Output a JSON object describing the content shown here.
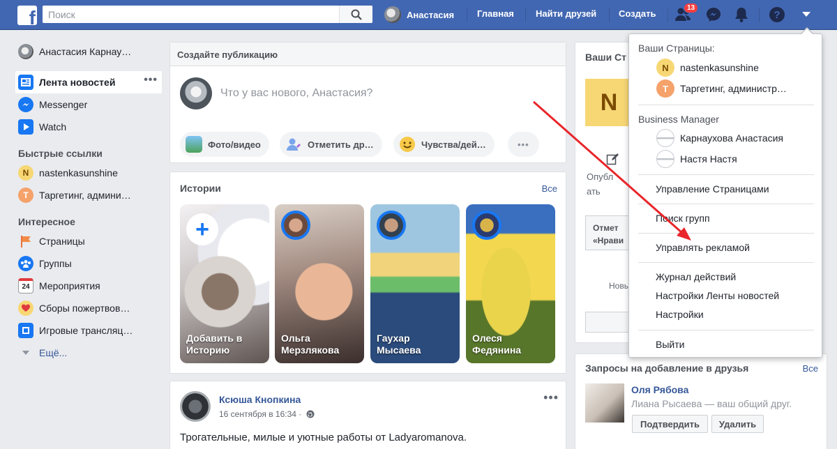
{
  "header": {
    "search_placeholder": "Поиск",
    "user_name": "Анастасия",
    "home": "Главная",
    "find_friends": "Найти друзей",
    "create": "Создать",
    "friend_requests_badge": "13"
  },
  "sidebar": {
    "profile_name": "Анастасия Карнау…",
    "items": [
      {
        "label": "Лента новостей"
      },
      {
        "label": "Messenger"
      },
      {
        "label": "Watch"
      }
    ],
    "shortcuts_title": "Быстрые ссылки",
    "shortcuts": [
      {
        "label": "nastenkasunshine",
        "letter": "N"
      },
      {
        "label": "Таргетинг, админи…",
        "letter": "T"
      }
    ],
    "explore_title": "Интересное",
    "explore": [
      {
        "label": "Страницы"
      },
      {
        "label": "Группы"
      },
      {
        "label": "Мероприятия",
        "icon_text": "24"
      },
      {
        "label": "Сборы пожертвов…"
      },
      {
        "label": "Игровые трансляц…"
      }
    ],
    "more": "Ещё..."
  },
  "composer": {
    "title": "Создайте публикацию",
    "placeholder": "Что у вас нового, Анастасия?",
    "actions": [
      {
        "label": "Фото/видео"
      },
      {
        "label": "Отметить др…"
      },
      {
        "label": "Чувства/дей…"
      }
    ]
  },
  "stories": {
    "title": "Истории",
    "see_all": "Все",
    "items": [
      {
        "name": "Добавить в\nИсторию"
      },
      {
        "name": "Ольга\nМерзлякова"
      },
      {
        "name": "Гаухар\nМысаева"
      },
      {
        "name": "Олеся\nФедянина"
      }
    ]
  },
  "post": {
    "author": "Ксюша Кнопкина",
    "time": "16 сентября в 16:34 ·",
    "text": "Трогательные, милые и уютные работы от Ladyaromanova."
  },
  "right_panel": {
    "title": "Ваши Ст",
    "tile_letter": "N",
    "publish_text": "Опубл\nать",
    "box_text": "Отмет\n«Нрави",
    "new_text": "Новы"
  },
  "friend_requests": {
    "title": "Запросы на добавление в друзья",
    "see_all": "Все",
    "name": "Оля Рябова",
    "mutual": "Лиана Рысаева — ваш общий друг.",
    "confirm": "Подтвердить",
    "delete": "Удалить"
  },
  "dropdown": {
    "pages_title": "Ваши Страницы:",
    "pages": [
      {
        "letter": "N",
        "label": "nastenkasunshine"
      },
      {
        "letter": "T",
        "label": "Таргетинг, администр…"
      }
    ],
    "bm_title": "Business Manager",
    "bm_accounts": [
      {
        "label": "Карнаухова Анастасия"
      },
      {
        "label": "Настя Настя"
      }
    ],
    "manage_pages": "Управление Страницами",
    "group_search": "Поиск групп",
    "manage_ads": "Управлять рекламой",
    "activity_log": "Журнал действий",
    "news_feed_settings": "Настройки Ленты новостей",
    "settings": "Настройки",
    "logout": "Выйти"
  },
  "colors": {
    "topbar": "#4267b2",
    "link": "#365899",
    "annotation_arrow": "#e8262b"
  }
}
